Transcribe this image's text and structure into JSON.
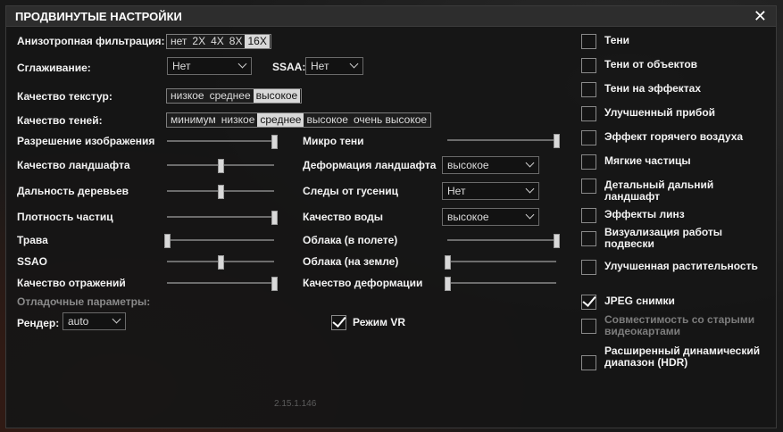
{
  "title": "ПРОДВИНУТЫЕ НАСТРОЙКИ",
  "aniso": {
    "label": "Анизотропная фильтрация:",
    "options": [
      "нет",
      "2X",
      "4X",
      "8X",
      "16X"
    ],
    "selected": "16X"
  },
  "aa": {
    "label": "Сглаживание:",
    "value": "Нет",
    "ssaa_label": "SSAA:",
    "ssaa_value": "Нет"
  },
  "texture": {
    "label": "Качество текстур:",
    "options": [
      "низкое",
      "среднее",
      "высокое"
    ],
    "selected": "высокое"
  },
  "shadows": {
    "label": "Качество теней:",
    "options": [
      "минимум",
      "низкое",
      "среднее",
      "высокое",
      "очень высокое"
    ],
    "selected": "среднее"
  },
  "left_sliders": [
    {
      "label": "Разрешение изображения",
      "value": 1.0
    },
    {
      "label": "Качество ландшафта",
      "value": 0.5
    },
    {
      "label": "Дальность деревьев",
      "value": 0.5
    },
    {
      "label": "Плотность частиц",
      "value": 1.0
    },
    {
      "label": "Трава",
      "value": 0.0
    },
    {
      "label": "SSAO",
      "value": 0.5
    },
    {
      "label": "Качество отражений",
      "value": 1.0
    }
  ],
  "mid": {
    "micro_shadows": {
      "label": "Микро тени",
      "value": 1.0
    },
    "terrain_deform": {
      "label": "Деформация ландшафта",
      "value": "высокое"
    },
    "tracks": {
      "label": "Следы от гусениц",
      "value": "Нет"
    },
    "water": {
      "label": "Качество воды",
      "value": "высокое"
    },
    "clouds_flight": {
      "label": "Облака (в полете)",
      "value": 1.0
    },
    "clouds_ground": {
      "label": "Облака (на земле)",
      "value": 0.0
    },
    "deform_quality": {
      "label": "Качество деформации",
      "value": 0.0
    }
  },
  "debug": {
    "label": "Отладочные параметры:",
    "renderer_label": "Рендер:",
    "renderer_value": "auto",
    "vr_label": "Режим VR",
    "vr_checked": true
  },
  "checkboxes": [
    {
      "label": "Тени",
      "checked": false,
      "enabled": true
    },
    {
      "label": "Тени от объектов",
      "checked": false,
      "enabled": true
    },
    {
      "label": "Тени на эффектах",
      "checked": false,
      "enabled": true
    },
    {
      "label": "Улучшенный прибой",
      "checked": false,
      "enabled": true
    },
    {
      "label": "Эффект горячего воздуха",
      "checked": false,
      "enabled": true
    },
    {
      "label": "Мягкие частицы",
      "checked": false,
      "enabled": true
    },
    {
      "label": "Детальный дальний ландшафт",
      "checked": false,
      "enabled": true
    },
    {
      "label": "Эффекты линз",
      "checked": false,
      "enabled": true
    },
    {
      "label": "Визуализация работы подвески",
      "checked": false,
      "enabled": true
    },
    {
      "label": "Улучшенная растительность",
      "checked": false,
      "enabled": true
    },
    {
      "label": "JPEG снимки",
      "checked": true,
      "enabled": true
    },
    {
      "label": "Совместимость со старыми видеокартами",
      "checked": false,
      "enabled": false
    },
    {
      "label": "Расширенный динамический диапазон (HDR)",
      "checked": false,
      "enabled": true
    }
  ],
  "version": "2.15.1.146"
}
